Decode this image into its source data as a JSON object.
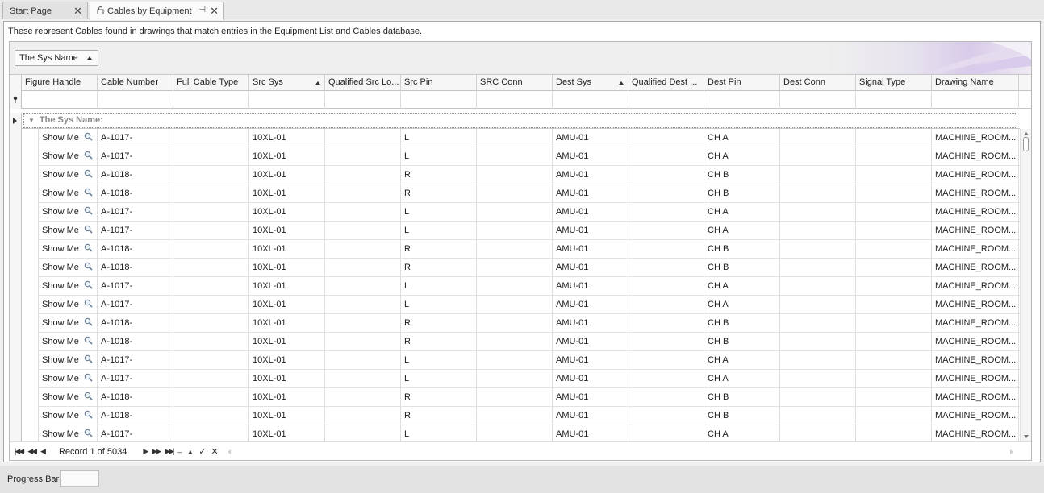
{
  "tabs": [
    {
      "label": "Start Page",
      "active": false
    },
    {
      "label": "Cables by Equipment",
      "active": true
    }
  ],
  "description": "These represent Cables found in drawings that match entries in the Equipment List and Cables database.",
  "group_panel": {
    "group_column": "The Sys Name"
  },
  "columns": [
    {
      "label": "Figure Handle"
    },
    {
      "label": "Cable Number"
    },
    {
      "label": "Full Cable Type"
    },
    {
      "label": "Src Sys",
      "sort": "asc"
    },
    {
      "label": "Qualified Src Lo..."
    },
    {
      "label": "Src Pin"
    },
    {
      "label": "SRC Conn"
    },
    {
      "label": "Dest Sys",
      "sort": "asc"
    },
    {
      "label": "Qualified Dest ..."
    },
    {
      "label": "Dest Pin"
    },
    {
      "label": "Dest Conn"
    },
    {
      "label": "Signal Type"
    },
    {
      "label": "Drawing Name"
    }
  ],
  "group_row": {
    "label": "The Sys Name:"
  },
  "rows": [
    [
      "Show Me",
      "A-1017-",
      "",
      "10XL-01",
      "",
      "L",
      "",
      "AMU-01",
      "",
      "CH A",
      "",
      "",
      "MACHINE_ROOM..."
    ],
    [
      "Show Me",
      "A-1017-",
      "",
      "10XL-01",
      "",
      "L",
      "",
      "AMU-01",
      "",
      "CH A",
      "",
      "",
      "MACHINE_ROOM..."
    ],
    [
      "Show Me",
      "A-1018-",
      "",
      "10XL-01",
      "",
      "R",
      "",
      "AMU-01",
      "",
      "CH B",
      "",
      "",
      "MACHINE_ROOM..."
    ],
    [
      "Show Me",
      "A-1018-",
      "",
      "10XL-01",
      "",
      "R",
      "",
      "AMU-01",
      "",
      "CH B",
      "",
      "",
      "MACHINE_ROOM..."
    ],
    [
      "Show Me",
      "A-1017-",
      "",
      "10XL-01",
      "",
      "L",
      "",
      "AMU-01",
      "",
      "CH A",
      "",
      "",
      "MACHINE_ROOM..."
    ],
    [
      "Show Me",
      "A-1017-",
      "",
      "10XL-01",
      "",
      "L",
      "",
      "AMU-01",
      "",
      "CH A",
      "",
      "",
      "MACHINE_ROOM..."
    ],
    [
      "Show Me",
      "A-1018-",
      "",
      "10XL-01",
      "",
      "R",
      "",
      "AMU-01",
      "",
      "CH B",
      "",
      "",
      "MACHINE_ROOM..."
    ],
    [
      "Show Me",
      "A-1018-",
      "",
      "10XL-01",
      "",
      "R",
      "",
      "AMU-01",
      "",
      "CH B",
      "",
      "",
      "MACHINE_ROOM..."
    ],
    [
      "Show Me",
      "A-1017-",
      "",
      "10XL-01",
      "",
      "L",
      "",
      "AMU-01",
      "",
      "CH A",
      "",
      "",
      "MACHINE_ROOM..."
    ],
    [
      "Show Me",
      "A-1017-",
      "",
      "10XL-01",
      "",
      "L",
      "",
      "AMU-01",
      "",
      "CH A",
      "",
      "",
      "MACHINE_ROOM..."
    ],
    [
      "Show Me",
      "A-1018-",
      "",
      "10XL-01",
      "",
      "R",
      "",
      "AMU-01",
      "",
      "CH B",
      "",
      "",
      "MACHINE_ROOM..."
    ],
    [
      "Show Me",
      "A-1018-",
      "",
      "10XL-01",
      "",
      "R",
      "",
      "AMU-01",
      "",
      "CH B",
      "",
      "",
      "MACHINE_ROOM..."
    ],
    [
      "Show Me",
      "A-1017-",
      "",
      "10XL-01",
      "",
      "L",
      "",
      "AMU-01",
      "",
      "CH A",
      "",
      "",
      "MACHINE_ROOM..."
    ],
    [
      "Show Me",
      "A-1017-",
      "",
      "10XL-01",
      "",
      "L",
      "",
      "AMU-01",
      "",
      "CH A",
      "",
      "",
      "MACHINE_ROOM..."
    ],
    [
      "Show Me",
      "A-1018-",
      "",
      "10XL-01",
      "",
      "R",
      "",
      "AMU-01",
      "",
      "CH B",
      "",
      "",
      "MACHINE_ROOM..."
    ],
    [
      "Show Me",
      "A-1018-",
      "",
      "10XL-01",
      "",
      "R",
      "",
      "AMU-01",
      "",
      "CH B",
      "",
      "",
      "MACHINE_ROOM..."
    ],
    [
      "Show Me",
      "A-1017-",
      "",
      "10XL-01",
      "",
      "L",
      "",
      "AMU-01",
      "",
      "CH A",
      "",
      "",
      "MACHINE_ROOM..."
    ]
  ],
  "navigator": {
    "record_text": "Record 1 of 5034"
  },
  "status_bar": {
    "progress_label": "Progress Bar"
  },
  "icons": {
    "show_me": "magnifier-icon",
    "tab_close": "close-icon",
    "tab_pin": "pin-icon",
    "tab_lock": "lock-icon",
    "filter": "filter-pin-icon"
  }
}
